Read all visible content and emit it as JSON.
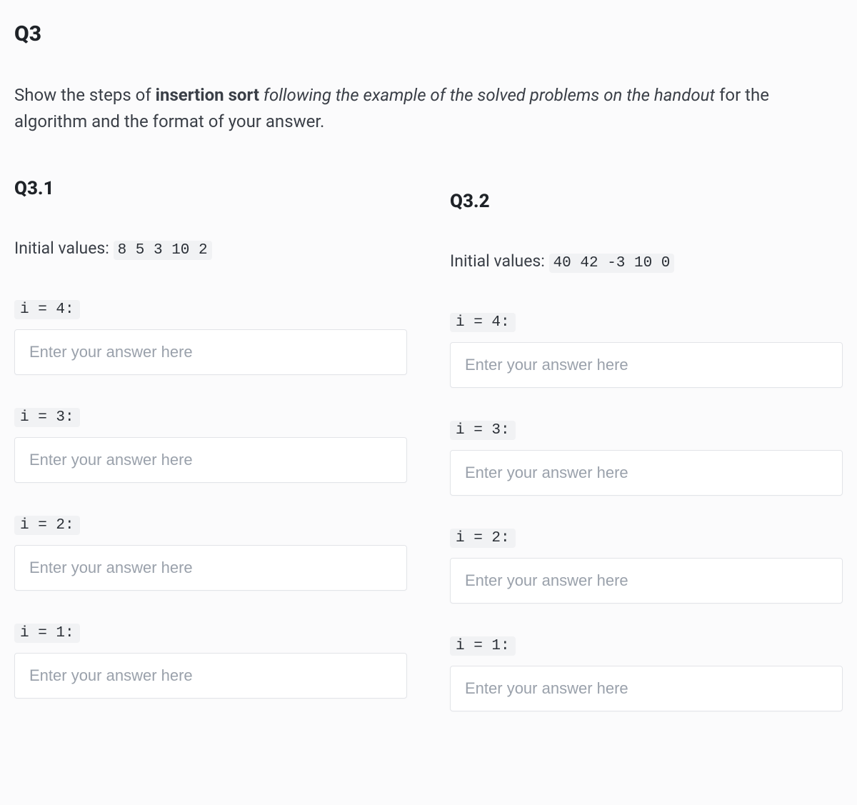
{
  "question": {
    "title": "Q3",
    "prompt_pre": "Show the steps of ",
    "prompt_bold": "insertion sort",
    "prompt_italic": " following the example of the solved problems on the handout",
    "prompt_post": " for the algorithm and the format of your answer."
  },
  "placeholder": "Enter your answer here",
  "left": {
    "title": "Q3.1",
    "initial_label": "Initial values: ",
    "initial_values": "8  5  3  10  2",
    "steps": [
      {
        "label": "i = 4:"
      },
      {
        "label": "i = 3:"
      },
      {
        "label": "i = 2:"
      },
      {
        "label": "i = 1:"
      }
    ]
  },
  "right": {
    "title": "Q3.2",
    "initial_label": "Initial values: ",
    "initial_values": "40  42  -3  10  0",
    "steps": [
      {
        "label": "i = 4:"
      },
      {
        "label": "i = 3:"
      },
      {
        "label": "i = 2:"
      },
      {
        "label": "i = 1:"
      }
    ]
  }
}
